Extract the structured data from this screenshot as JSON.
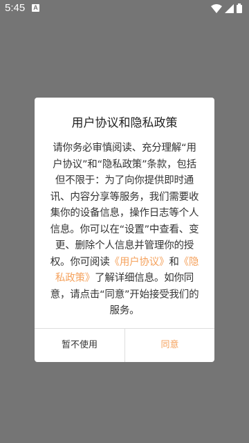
{
  "status_bar": {
    "time": "5:45",
    "notification_badge": "A",
    "icons": [
      "wifi-icon",
      "signal-icon",
      "battery-icon"
    ]
  },
  "dialog": {
    "title": "用户协议和隐私政策",
    "body_part1": "请你务必审慎阅读、充分理解“用户协议”和“隐私政策”条款，包括但不限于：为了向你提供即时通讯、内容分享等服务，我们需要收集你的设备信息，操作日志等个人信息。你可以在“设置”中查看、变更、删除个人信息并管理你的授权。你可阅读",
    "link_user_agreement": "《用户协议》",
    "connector": "和",
    "link_privacy_policy": "《隐私政策》",
    "body_part2": "了解详细信息。如你同意，请点击“同意”开始接受我们的服务。",
    "decline_label": "暂不使用",
    "agree_label": "同意"
  },
  "colors": {
    "overlay": "#757575",
    "accent": "#f5a25d",
    "text": "#333333"
  }
}
